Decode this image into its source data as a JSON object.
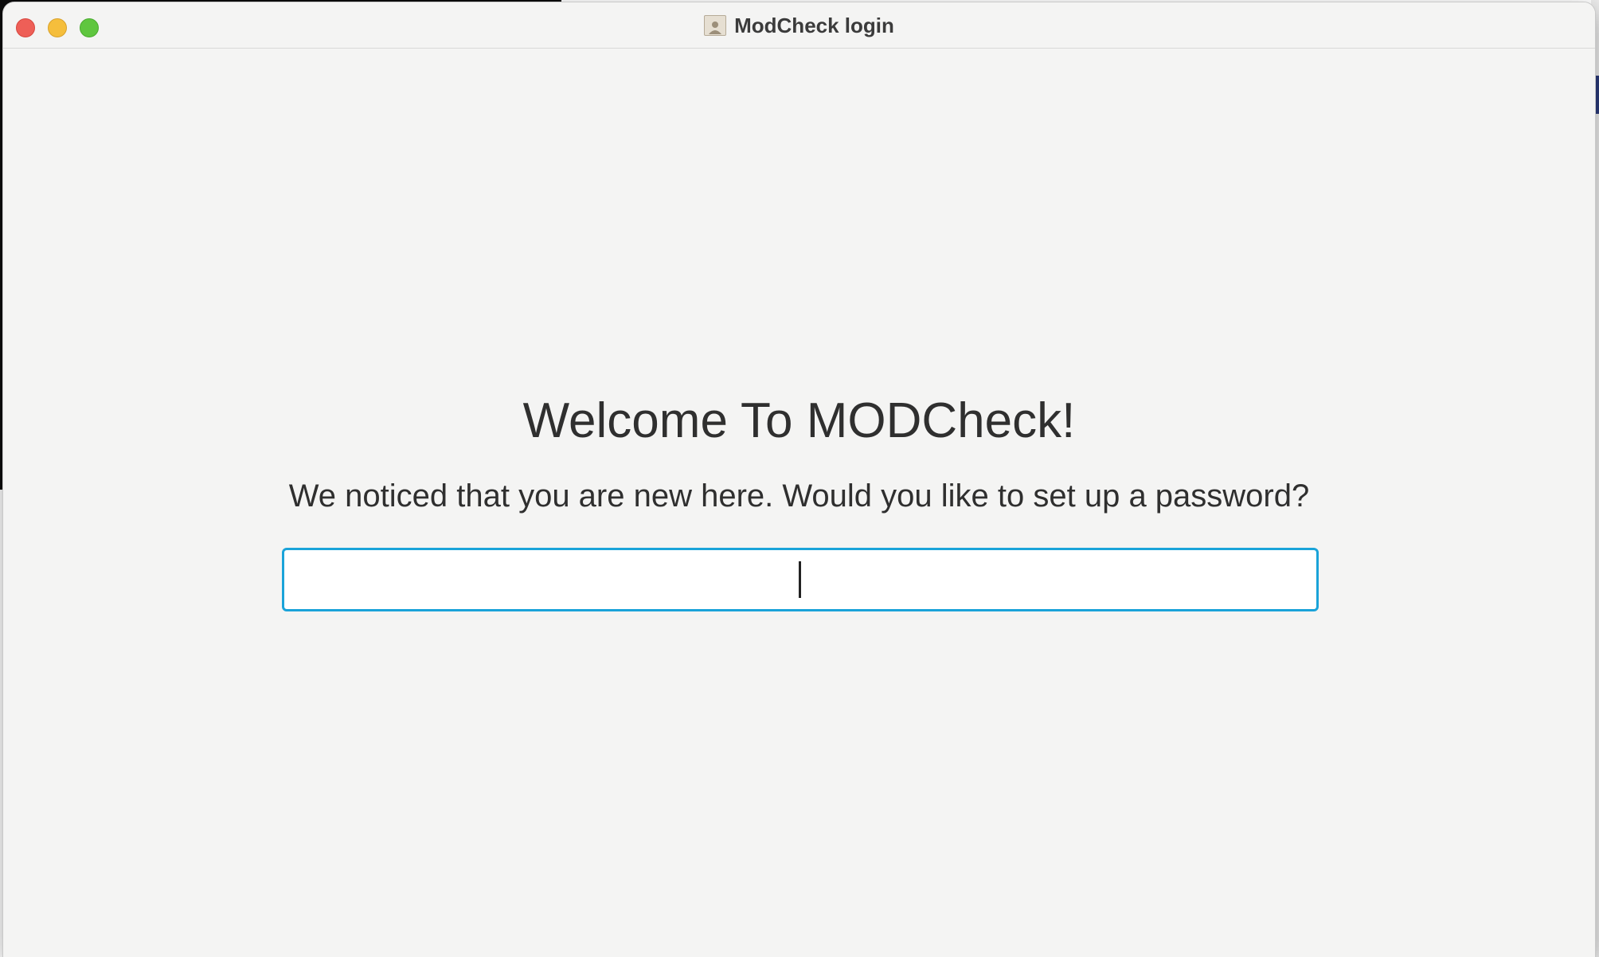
{
  "window": {
    "title": "ModCheck login"
  },
  "icons": {
    "close": "close-icon",
    "minimize": "minimize-icon",
    "maximize": "maximize-icon",
    "app": "contact-book-icon"
  },
  "main": {
    "heading": "Welcome To MODCheck!",
    "prompt": "We noticed that you are new here. Would you like to set up a password?",
    "password_value": "",
    "password_placeholder": ""
  },
  "colors": {
    "focus_ring": "#1aa3d9",
    "close": "#ee5f57",
    "minimize": "#f5be3c",
    "maximize": "#5fc63f",
    "window_bg": "#f4f4f3"
  }
}
